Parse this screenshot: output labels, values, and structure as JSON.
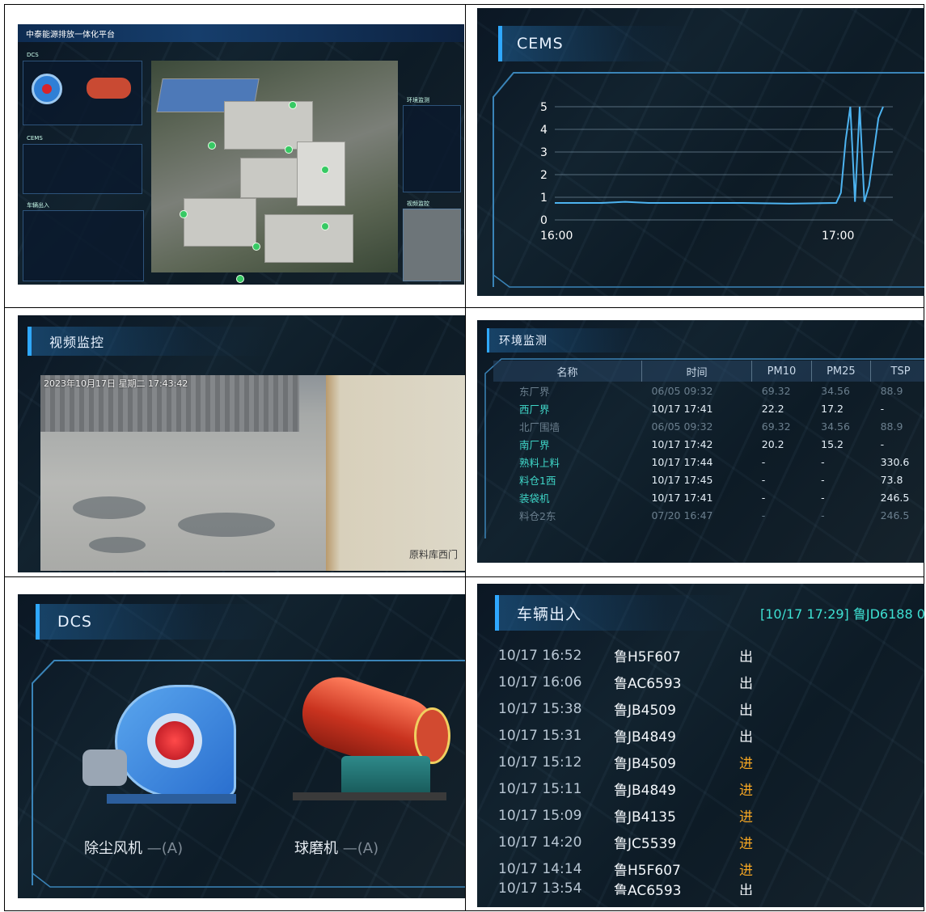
{
  "dashboard": {
    "title": "中泰能源排放一体化平台",
    "panels": [
      "DCS",
      "CEMS",
      "环境监测",
      "车辆出入",
      "视频监控"
    ]
  },
  "cems": {
    "title": "CEMS",
    "chart_data": {
      "type": "line",
      "title": "",
      "xlabel": "",
      "ylabel": "",
      "x_ticks": [
        "16:00",
        "17:00"
      ],
      "y_ticks": [
        0,
        1,
        2,
        3,
        4,
        5
      ],
      "ylim": [
        0,
        5
      ],
      "grid": true,
      "series": [
        {
          "x": [
            "16:00",
            "16:10",
            "16:15",
            "16:20",
            "16:30",
            "16:40",
            "16:50",
            "17:00",
            "17:01",
            "17:02",
            "17:03",
            "17:04",
            "17:05",
            "17:06",
            "17:07",
            "17:08",
            "17:09",
            "17:10"
          ],
          "values": [
            0.75,
            0.75,
            0.8,
            0.75,
            0.75,
            0.75,
            0.72,
            0.75,
            1.2,
            3.5,
            5.0,
            0.8,
            5.0,
            0.8,
            1.5,
            3.0,
            4.5,
            5.0
          ]
        }
      ],
      "line_color": "#4db3f0"
    }
  },
  "video": {
    "title": "视频监控",
    "timestamp": "2023年10月17日 星期二 17:43:42",
    "caption": "原料库西门"
  },
  "env": {
    "title": "环境监测",
    "columns": [
      "名称",
      "时间",
      "PM10",
      "PM25",
      "TSP"
    ],
    "rows": [
      {
        "name": "东厂界",
        "time": "06/05 09:32",
        "pm10": "69.32",
        "pm25": "34.56",
        "tsp": "88.9",
        "active": false
      },
      {
        "name": "西厂界",
        "time": "10/17 17:41",
        "pm10": "22.2",
        "pm25": "17.2",
        "tsp": "-",
        "active": true
      },
      {
        "name": "北厂围墙",
        "time": "06/05 09:32",
        "pm10": "69.32",
        "pm25": "34.56",
        "tsp": "88.9",
        "active": false
      },
      {
        "name": "南厂界",
        "time": "10/17 17:42",
        "pm10": "20.2",
        "pm25": "15.2",
        "tsp": "-",
        "active": true
      },
      {
        "name": "熟料上料",
        "time": "10/17 17:44",
        "pm10": "-",
        "pm25": "-",
        "tsp": "330.6",
        "active": true
      },
      {
        "name": "料仓1西",
        "time": "10/17 17:45",
        "pm10": "-",
        "pm25": "-",
        "tsp": "73.8",
        "active": true
      },
      {
        "name": "装袋机",
        "time": "10/17 17:41",
        "pm10": "-",
        "pm25": "-",
        "tsp": "246.5",
        "active": true
      },
      {
        "name": "料仓2东",
        "time": "07/20 16:47",
        "pm10": "-",
        "pm25": "-",
        "tsp": "246.5",
        "active": false
      }
    ]
  },
  "dcs": {
    "title": "DCS",
    "devices": [
      {
        "name": "除尘风机",
        "status": "(A)"
      },
      {
        "name": "球磨机",
        "status": "(A)"
      }
    ]
  },
  "vehicles": {
    "title": "车辆出入",
    "ticker": "[10/17 17:29] 鲁JD6188 0",
    "rows": [
      {
        "time": "10/17 16:52",
        "plate": "鲁H5F607",
        "dir": "出"
      },
      {
        "time": "10/17 16:06",
        "plate": "鲁AC6593",
        "dir": "出"
      },
      {
        "time": "10/17 15:38",
        "plate": "鲁JB4509",
        "dir": "出"
      },
      {
        "time": "10/17 15:31",
        "plate": "鲁JB4849",
        "dir": "出"
      },
      {
        "time": "10/17 15:12",
        "plate": "鲁JB4509",
        "dir": "进"
      },
      {
        "time": "10/17 15:11",
        "plate": "鲁JB4849",
        "dir": "进"
      },
      {
        "time": "10/17 15:09",
        "plate": "鲁JB4135",
        "dir": "进"
      },
      {
        "time": "10/17 14:20",
        "plate": "鲁JC5539",
        "dir": "进"
      },
      {
        "time": "10/17 14:14",
        "plate": "鲁H5F607",
        "dir": "进"
      },
      {
        "time": "10/17 13:54",
        "plate": "鲁AC6593",
        "dir": "出"
      }
    ]
  },
  "colors": {
    "accent": "#2fa8ff",
    "in": "#f5a623",
    "teal": "#3fd6c8"
  }
}
